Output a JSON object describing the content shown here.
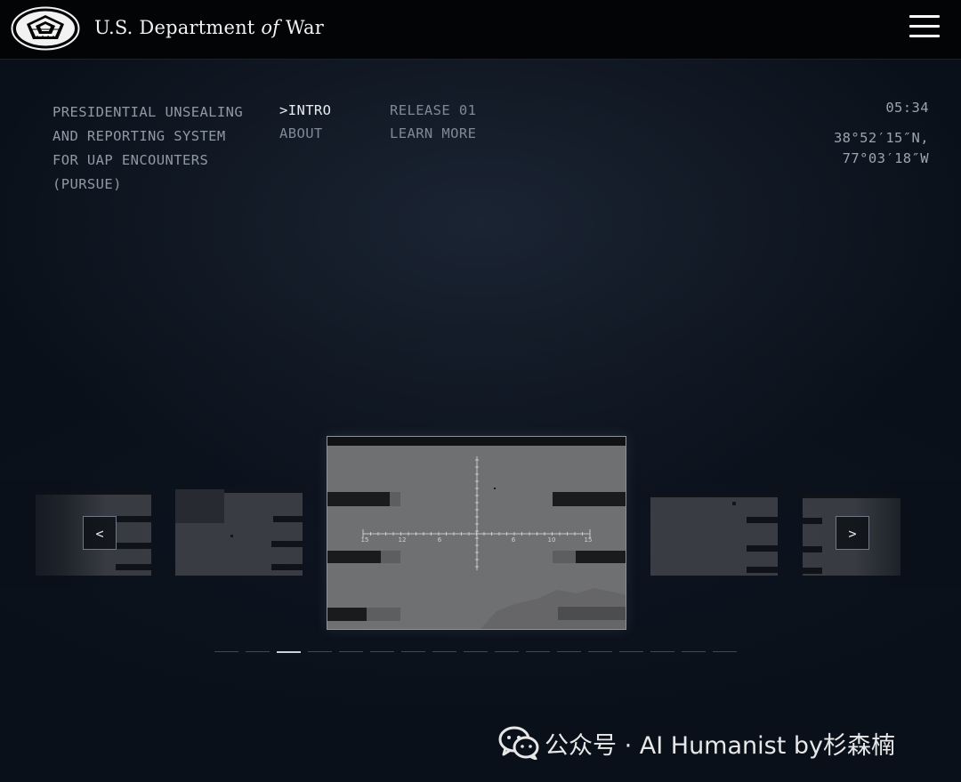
{
  "header": {
    "brand_prefix": "U.S. Department ",
    "brand_of": "of",
    "brand_suffix": " War",
    "seal_icon": "pentagon-seal-icon",
    "menu_icon": "hamburger-menu-icon"
  },
  "system_title": [
    "PRESIDENTIAL UNSEALING",
    "AND REPORTING SYSTEM",
    "FOR UAP ENCOUNTERS",
    "(PURSUE)"
  ],
  "nav": {
    "col1": [
      {
        "label": ">INTRO",
        "active": true
      },
      {
        "label": "ABOUT",
        "active": false
      }
    ],
    "col2": [
      {
        "label": "RELEASE 01",
        "active": false
      },
      {
        "label": "LEARN MORE",
        "active": false
      }
    ]
  },
  "status": {
    "time": "05:34",
    "lat": "38°52′15″N,",
    "lon": "77°03′18″W"
  },
  "carousel": {
    "prev_label": "<",
    "next_label": ">",
    "reticle_scale": [
      "15",
      "12",
      "6",
      "0",
      "6",
      "10",
      "15"
    ],
    "page_count": 17,
    "active_page": 2
  },
  "watermark": {
    "text": "公众号 · AI Humanist by杉森楠",
    "icon": "wechat-icon"
  },
  "colors": {
    "header_bg": "#030405",
    "page_bg": "#0a1019",
    "active_text": "#e8ecf1",
    "dim_text": "#7f8996"
  }
}
